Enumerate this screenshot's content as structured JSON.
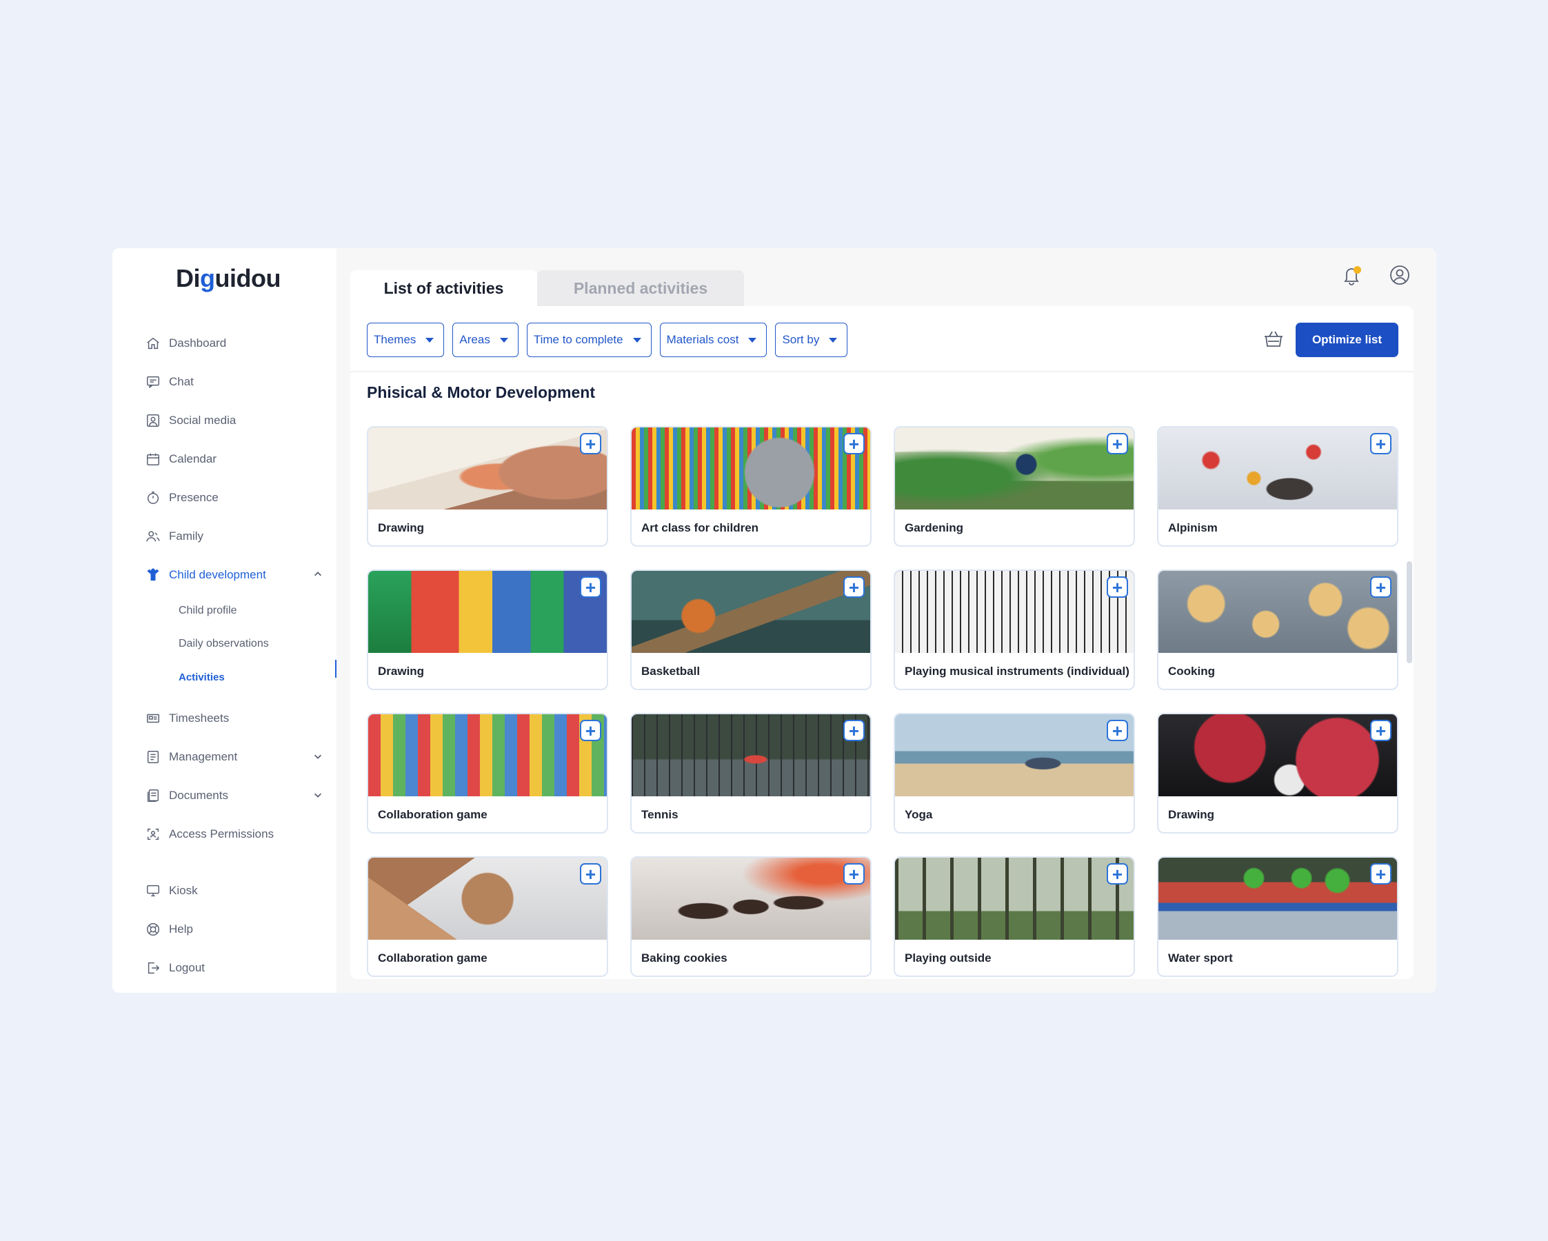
{
  "app": {
    "logo": "Diguidou"
  },
  "sidebar": {
    "items": [
      {
        "id": "dashboard",
        "label": "Dashboard",
        "icon": "home-icon"
      },
      {
        "id": "chat",
        "label": "Chat",
        "icon": "chat-icon"
      },
      {
        "id": "social",
        "label": "Social media",
        "icon": "social-icon"
      },
      {
        "id": "calendar",
        "label": "Calendar",
        "icon": "calendar-icon"
      },
      {
        "id": "presence",
        "label": "Presence",
        "icon": "stopwatch-icon"
      },
      {
        "id": "family",
        "label": "Family",
        "icon": "family-icon"
      },
      {
        "id": "child",
        "label": "Child development",
        "icon": "child-icon"
      }
    ],
    "sub_items": [
      "Child profile",
      "Daily observations",
      "Activities"
    ],
    "items2": [
      {
        "id": "timesheets",
        "label": "Timesheets",
        "icon": "timesheet-icon"
      },
      {
        "id": "management",
        "label": "Management",
        "icon": "management-icon"
      },
      {
        "id": "documents",
        "label": "Documents",
        "icon": "documents-icon"
      },
      {
        "id": "access",
        "label": "Access Permissions",
        "icon": "access-icon"
      }
    ],
    "items3": [
      {
        "id": "kiosk",
        "label": "Kiosk",
        "icon": "monitor-icon"
      },
      {
        "id": "help",
        "label": "Help",
        "icon": "lifebuoy-icon"
      },
      {
        "id": "logout",
        "label": "Logout",
        "icon": "logout-icon"
      }
    ]
  },
  "tabs": {
    "list": "List of activities",
    "planned": "Planned activities"
  },
  "filters": [
    "Themes",
    "Areas",
    "Time to complete",
    "Materials cost",
    "Sort by"
  ],
  "actions": {
    "optimize": "Optimize list",
    "add_symbol": "+"
  },
  "section": {
    "title": "Phisical & Motor Development"
  },
  "activities": [
    {
      "label": "Drawing",
      "scene": "drawing-hand"
    },
    {
      "label": "Art class for children",
      "scene": "art-supplies"
    },
    {
      "label": "Gardening",
      "scene": "greenhouse"
    },
    {
      "label": "Alpinism",
      "scene": "climbing-wall"
    },
    {
      "label": "Drawing",
      "scene": "colour-blocks"
    },
    {
      "label": "Basketball",
      "scene": "basketball-hoop"
    },
    {
      "label": "Playing musical instruments (individual)",
      "scene": "keyboard"
    },
    {
      "label": "Cooking",
      "scene": "cookies-tray"
    },
    {
      "label": "Collaboration game",
      "scene": "xylophone-toy"
    },
    {
      "label": "Tennis",
      "scene": "tennis-court"
    },
    {
      "label": "Yoga",
      "scene": "beach-yoga"
    },
    {
      "label": "Drawing",
      "scene": "red-lego"
    },
    {
      "label": "Collaboration game",
      "scene": "fist-bump"
    },
    {
      "label": "Baking cookies",
      "scene": "chocolate-hearts"
    },
    {
      "label": "Playing outside",
      "scene": "forest"
    },
    {
      "label": "Water sport",
      "scene": "rafting"
    }
  ]
}
